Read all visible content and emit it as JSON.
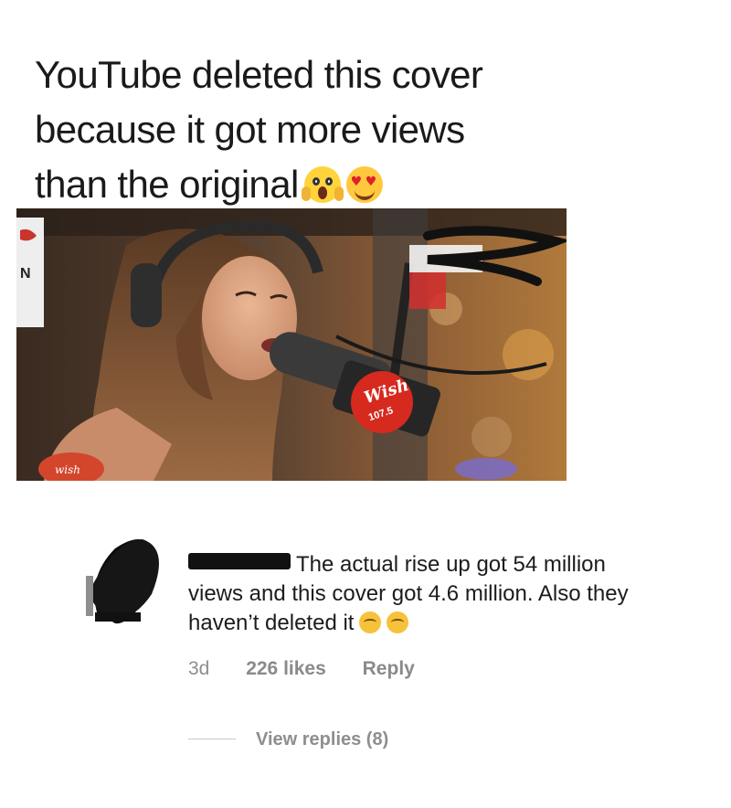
{
  "post": {
    "caption_lines": [
      "YouTube deleted this cover",
      "because it got more views",
      "than the original"
    ],
    "caption_emoji": [
      "face-screaming-in-fear-icon",
      "smiling-face-heart-eyes-icon"
    ]
  },
  "video": {
    "thumbnail_icon": "singer-at-microphone-thumbnail",
    "logo_text": "Wish",
    "logo_frequency": "107.5",
    "colors": {
      "logo_red": "#d62a1f",
      "background": "#2b1d16"
    }
  },
  "comment": {
    "text_line_1": "The actual rise up got 54 million",
    "text_line_2": "views and this cover got 4.6 million. Also they",
    "text_line_3": "haven’t deleted it",
    "trailing_emoji": [
      "face-with-monocle-icon",
      "face-with-monocle-icon"
    ],
    "age": "3d",
    "likes": "226 likes",
    "reply_label": "Reply"
  },
  "replies": {
    "label": "View replies (8)"
  },
  "colors": {
    "text_primary": "#1c1c1c",
    "text_secondary": "#8e8e8e",
    "redaction": "#111111"
  }
}
